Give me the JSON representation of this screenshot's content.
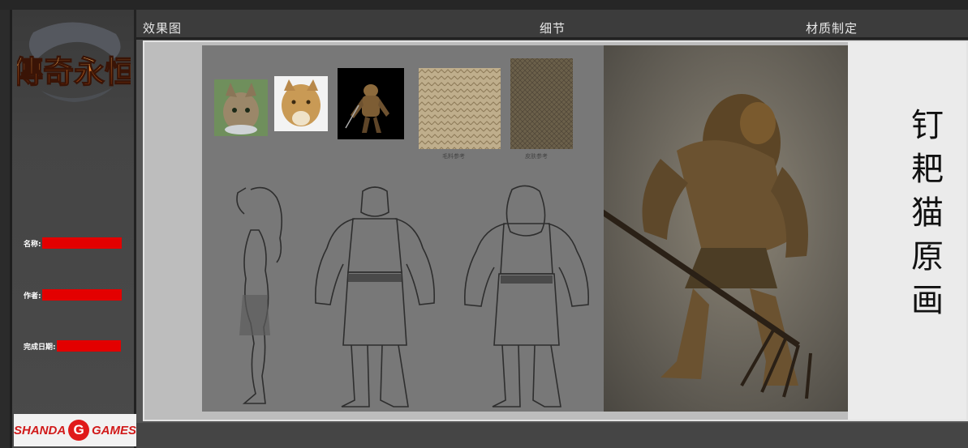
{
  "sidebar": {
    "logo_alt": "傳奇永恒",
    "fields": [
      {
        "label": "名称:"
      },
      {
        "label": "作者:"
      },
      {
        "label": "完成日期:"
      }
    ],
    "brand_left": "SHANDA",
    "brand_mid": "G",
    "brand_right": "GAMES"
  },
  "tabs": [
    {
      "label": "效果图"
    },
    {
      "label": "细节"
    },
    {
      "label": "材质制定"
    }
  ],
  "main": {
    "title_chars": [
      "钉",
      "耙",
      "猫",
      "原",
      "画"
    ],
    "texture_captions": [
      "毛料参考",
      "皮肤参考"
    ]
  },
  "colors": {
    "redacted": "#e30000",
    "brand_red": "#d11a1a"
  }
}
